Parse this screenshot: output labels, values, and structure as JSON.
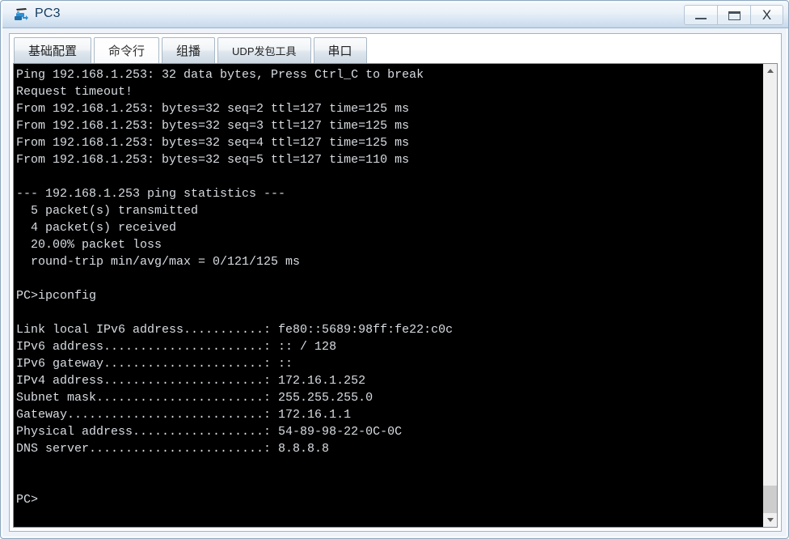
{
  "window": {
    "title": "PC3",
    "icon": "pc-device-icon",
    "controls": {
      "minimize_label": "Minimize",
      "maximize_label": "Maximize",
      "close_label": "X"
    }
  },
  "tabs": [
    {
      "id": "basic-config",
      "label": "基础配置",
      "active": false,
      "small": false
    },
    {
      "id": "command-line",
      "label": "命令行",
      "active": true,
      "small": false
    },
    {
      "id": "multicast",
      "label": "组播",
      "active": false,
      "small": false
    },
    {
      "id": "udp-packet-tool",
      "label": "UDP发包工具",
      "active": false,
      "small": true
    },
    {
      "id": "serial-port",
      "label": "串口",
      "active": false,
      "small": false
    }
  ],
  "terminal": {
    "background_color": "#000000",
    "text_color": "#d8dde2",
    "lines": [
      "Ping 192.168.1.253: 32 data bytes, Press Ctrl_C to break",
      "Request timeout!",
      "From 192.168.1.253: bytes=32 seq=2 ttl=127 time=125 ms",
      "From 192.168.1.253: bytes=32 seq=3 ttl=127 time=125 ms",
      "From 192.168.1.253: bytes=32 seq=4 ttl=127 time=125 ms",
      "From 192.168.1.253: bytes=32 seq=5 ttl=127 time=110 ms",
      "",
      "--- 192.168.1.253 ping statistics ---",
      "  5 packet(s) transmitted",
      "  4 packet(s) received",
      "  20.00% packet loss",
      "  round-trip min/avg/max = 0/121/125 ms",
      "",
      "PC>ipconfig",
      "",
      "Link local IPv6 address...........: fe80::5689:98ff:fe22:c0c",
      "IPv6 address......................: :: / 128",
      "IPv6 gateway......................: ::",
      "IPv4 address......................: 172.16.1.252",
      "Subnet mask.......................: 255.255.255.0",
      "Gateway...........................: 172.16.1.1",
      "Physical address..................: 54-89-98-22-0C-0C",
      "DNS server........................: 8.8.8.8",
      "",
      "",
      "PC>"
    ],
    "ping_summary": {
      "target": "192.168.1.253",
      "data_bytes": 32,
      "transmitted": 5,
      "received": 4,
      "packet_loss_percent": "20.00%",
      "rtt_min_ms": 0,
      "rtt_avg_ms": 121,
      "rtt_max_ms": 125
    },
    "ipconfig": {
      "link_local_ipv6_address": "fe80::5689:98ff:fe22:c0c",
      "ipv6_address": ":: / 128",
      "ipv6_gateway": "::",
      "ipv4_address": "172.16.1.252",
      "subnet_mask": "255.255.255.0",
      "gateway": "172.16.1.1",
      "physical_address": "54-89-98-22-0C-0C",
      "dns_server": "8.8.8.8"
    },
    "prompt": "PC>"
  },
  "scrollbar": {
    "up_arrow": "chevron-up-icon",
    "down_arrow": "chevron-down-icon",
    "thumb_position": "bottom"
  }
}
